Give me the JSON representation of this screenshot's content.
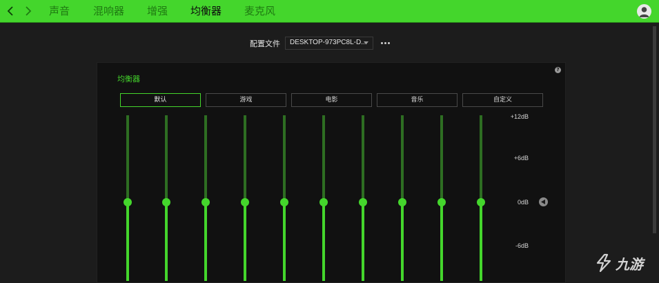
{
  "nav": {
    "tabs": [
      {
        "label": "声音",
        "active": false
      },
      {
        "label": "混响器",
        "active": false
      },
      {
        "label": "增强",
        "active": false
      },
      {
        "label": "均衡器",
        "active": true
      },
      {
        "label": "麦克风",
        "active": false
      }
    ]
  },
  "profile": {
    "label": "配置文件",
    "value": "DESKTOP-973PC8L-D..."
  },
  "equalizer": {
    "title": "均衡器",
    "help": "?",
    "presets": [
      {
        "label": "默认",
        "active": true
      },
      {
        "label": "游戏",
        "active": false
      },
      {
        "label": "电影",
        "active": false
      },
      {
        "label": "音乐",
        "active": false
      },
      {
        "label": "自定义",
        "active": false
      }
    ],
    "db_labels": [
      "+12dB",
      "+6dB",
      "0dB",
      "-6dB"
    ],
    "band_gains_db": [
      0,
      0,
      0,
      0,
      0,
      0,
      0,
      0,
      0,
      0
    ]
  },
  "watermark": {
    "text": "九游"
  },
  "colors": {
    "accent": "#44d62c",
    "track": "#2e6e22",
    "panel": "#111111",
    "background": "#1c1c1c"
  },
  "icons": {
    "back": "chevron-left-icon",
    "forward": "chevron-right-icon",
    "avatar": "user-avatar-icon",
    "more": "more-dots-icon",
    "reset": "reset-arrow-icon"
  }
}
